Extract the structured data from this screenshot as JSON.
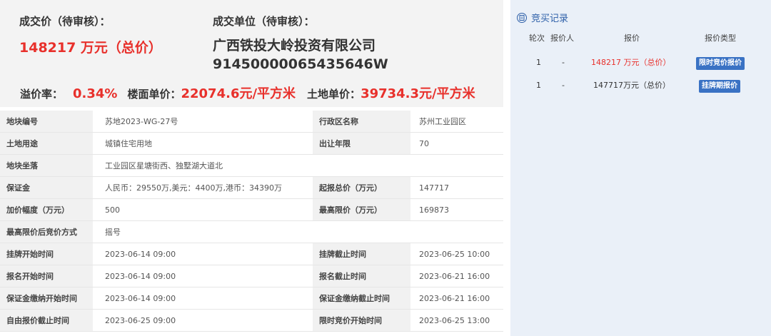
{
  "summary": {
    "price_label": "成交价（待审核）：",
    "price_value": "148217 万元（总价）",
    "winner_label": "成交单位（待审核）：",
    "winner_name": "广西铁投大岭投资有限公司",
    "winner_code": "91450000065435646W",
    "premium_label": "溢价率：",
    "premium_value": "0.34%",
    "floor_price_label": "楼面单价：",
    "floor_price_value": "22074.6元/平方米",
    "land_price_label": "土地单价：",
    "land_price_value": "39734.3元/平方米"
  },
  "info": {
    "rows": [
      {
        "k1": "地块编号",
        "v1": "苏地2023-WG-27号",
        "k2": "行政区名称",
        "v2": "苏州工业园区"
      },
      {
        "k1": "土地用途",
        "v1": "城镇住宅用地",
        "k2": "出让年限",
        "v2": "70"
      },
      {
        "k1": "地块坐落",
        "v1": "工业园区星塘街西、独墅湖大道北"
      },
      {
        "k1": "保证金",
        "v1": "人民币：29550万,美元：4400万,港币：34390万",
        "k2": "起报总价（万元）",
        "v2": "147717"
      },
      {
        "k1": "加价幅度（万元）",
        "v1": "500",
        "k2": "最高限价（万元）",
        "v2": "169873"
      },
      {
        "k1": "最高限价后竞价方式",
        "v1": "摇号"
      },
      {
        "k1": "挂牌开始时间",
        "v1": "2023-06-14 09:00",
        "k2": "挂牌截止时间",
        "v2": "2023-06-25 10:00"
      },
      {
        "k1": "报名开始时间",
        "v1": "2023-06-14 09:00",
        "k2": "报名截止时间",
        "v2": "2023-06-21 16:00"
      },
      {
        "k1": "保证金缴纳开始时间",
        "v1": "2023-06-14 09:00",
        "k2": "保证金缴纳截止时间",
        "v2": "2023-06-21 16:00"
      },
      {
        "k1": "自由报价截止时间",
        "v1": "2023-06-25 09:00",
        "k2": "限时竞价开始时间",
        "v2": "2023-06-25 13:00"
      }
    ]
  },
  "records": {
    "title": "竞买记录",
    "icon": "document-icon",
    "headers": {
      "round": "轮次",
      "bidder": "报价人",
      "price": "报价",
      "type": "报价类型"
    },
    "rows": [
      {
        "round": "1",
        "bidder": "-",
        "price": "148217 万元（总价）",
        "type": "限时竞价报价",
        "price_color": "#e8302b",
        "badge_color": "#3a72c4"
      },
      {
        "round": "1",
        "bidder": "-",
        "price": "147717万元（总价）",
        "type": "挂牌期报价",
        "price_color": "#333333",
        "badge_color": "#3a72c4"
      }
    ]
  }
}
